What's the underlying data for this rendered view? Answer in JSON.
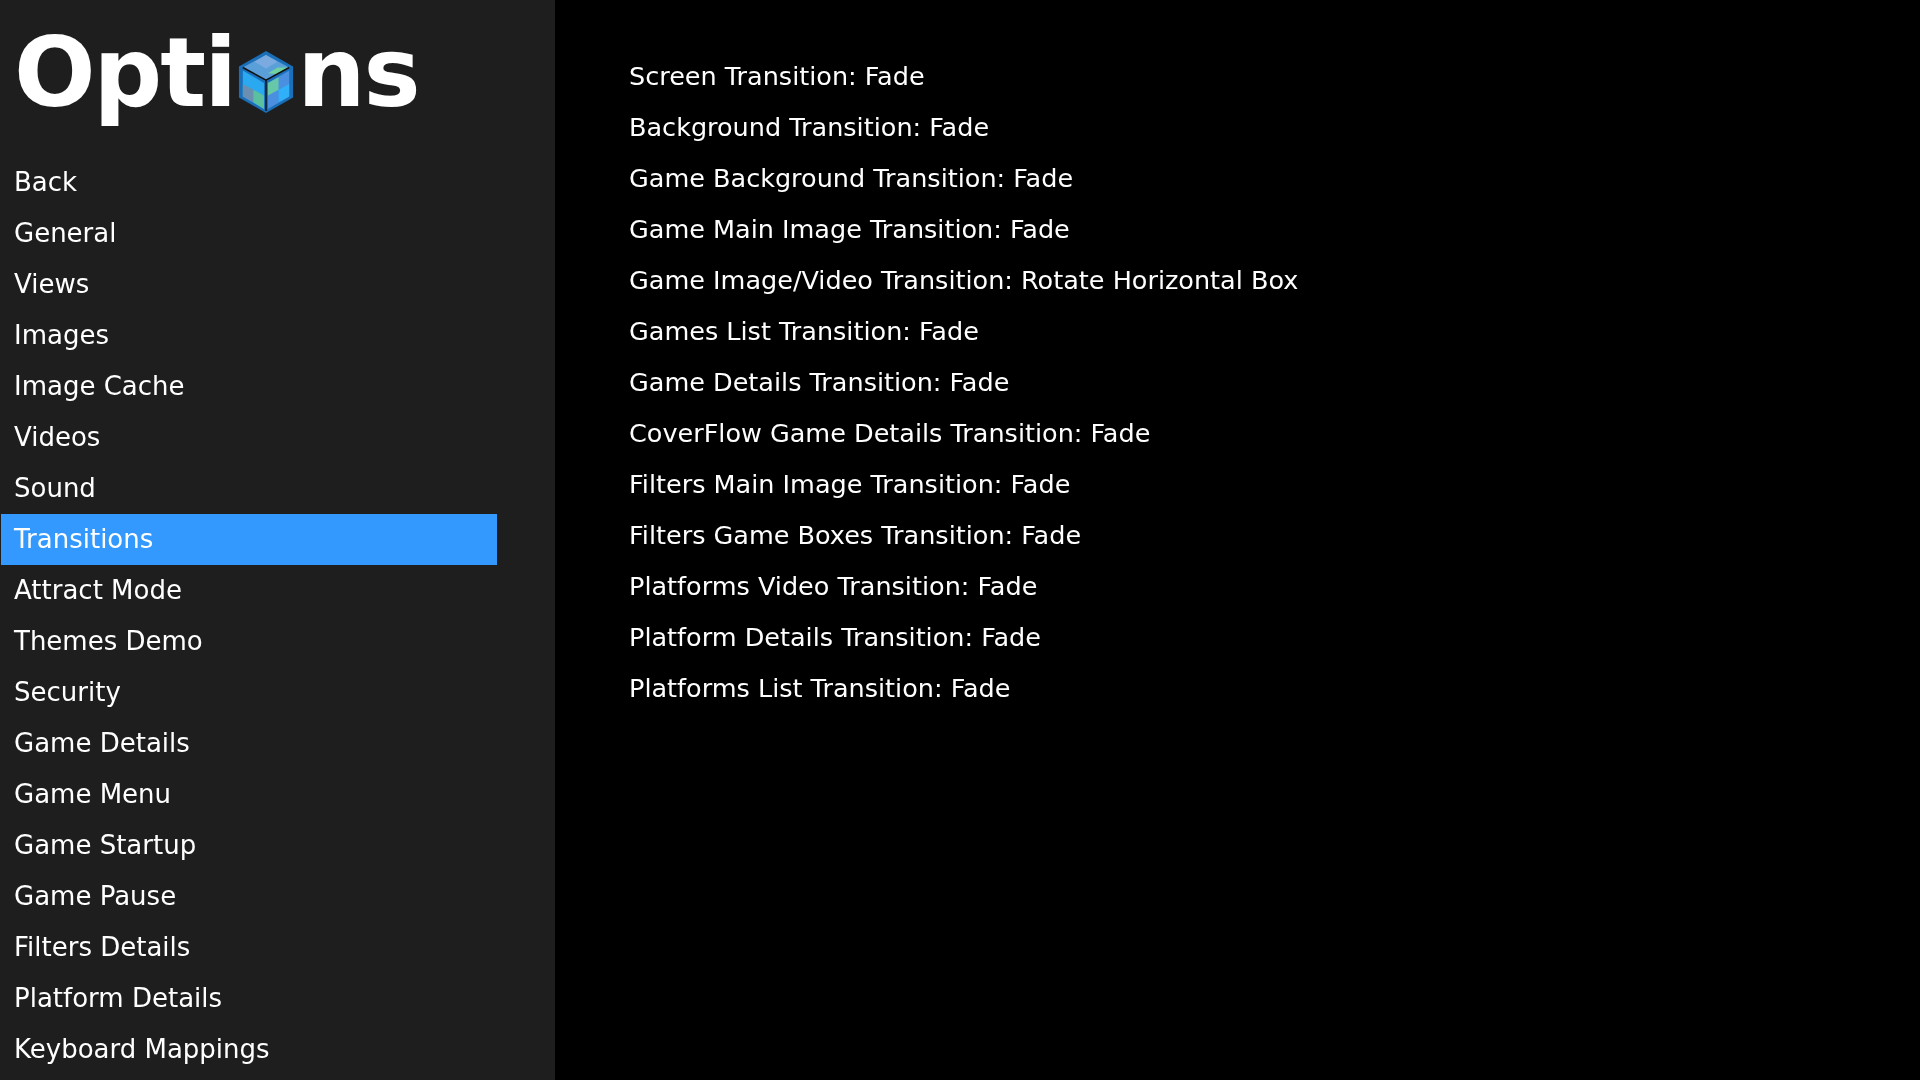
{
  "logo": {
    "text_before": "Opti",
    "text_after": "ns"
  },
  "menu": [
    {
      "label": "Back",
      "selected": false
    },
    {
      "label": "General",
      "selected": false
    },
    {
      "label": "Views",
      "selected": false
    },
    {
      "label": "Images",
      "selected": false
    },
    {
      "label": "Image Cache",
      "selected": false
    },
    {
      "label": "Videos",
      "selected": false
    },
    {
      "label": "Sound",
      "selected": false
    },
    {
      "label": "Transitions",
      "selected": true
    },
    {
      "label": "Attract Mode",
      "selected": false
    },
    {
      "label": "Themes Demo",
      "selected": false
    },
    {
      "label": "Security",
      "selected": false
    },
    {
      "label": "Game Details",
      "selected": false
    },
    {
      "label": "Game Menu",
      "selected": false
    },
    {
      "label": "Game Startup",
      "selected": false
    },
    {
      "label": "Game Pause",
      "selected": false
    },
    {
      "label": "Filters Details",
      "selected": false
    },
    {
      "label": "Platform Details",
      "selected": false
    },
    {
      "label": "Keyboard Mappings",
      "selected": false
    }
  ],
  "settings": [
    "Screen Transition: Fade",
    "Background Transition: Fade",
    "Game Background Transition: Fade",
    "Game Main Image Transition: Fade",
    "Game Image/Video Transition: Rotate Horizontal Box",
    "Games List Transition: Fade",
    "Game Details Transition: Fade",
    "CoverFlow Game Details Transition: Fade",
    "Filters Main Image Transition: Fade",
    "Filters Game Boxes Transition: Fade",
    "Platforms Video Transition: Fade",
    "Platform Details Transition: Fade",
    "Platforms List Transition: Fade"
  ]
}
